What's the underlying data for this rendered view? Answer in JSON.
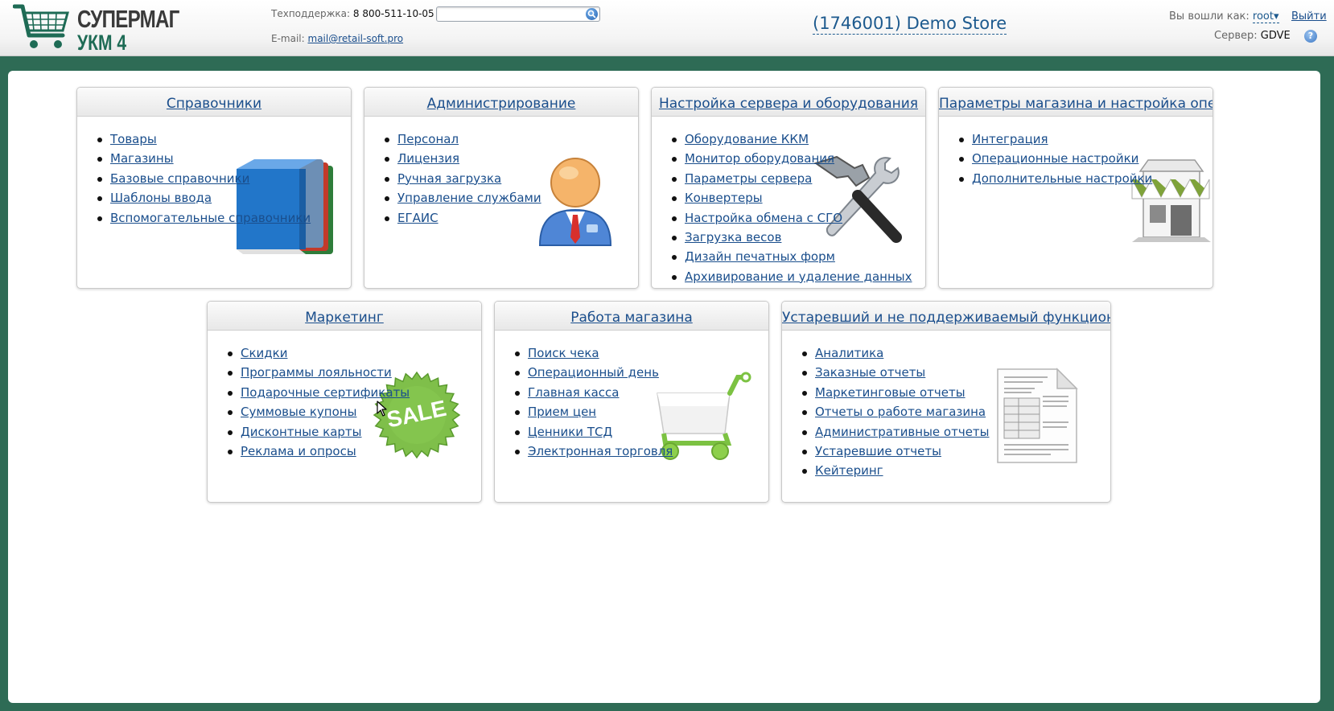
{
  "header": {
    "brand_line1": "СУПЕРМАГ",
    "brand_line2": "УКМ 4",
    "support_label": "Техподдержка:",
    "support_phone": "8 800-511-10-05",
    "email_label": "E-mail:",
    "email": "mail@retail-soft.pro",
    "search_value": "",
    "store_title": "(1746001) Demo Store",
    "login_label": "Вы вошли как:",
    "login_user": "root",
    "logout_label": "Выйти",
    "server_label": "Сервер:",
    "server_value": "GDVE",
    "help_glyph": "?"
  },
  "icons": {
    "logo": "shopping-cart-logo",
    "search": "search-icon",
    "help": "help-icon",
    "user_menu": "chevron-down-icon"
  },
  "colors": {
    "background": "#2e6b55",
    "link": "#1a4e8c",
    "brand_green": "#1e6b55"
  },
  "cards": {
    "directories": {
      "title": "Справочники",
      "items": [
        "Товары",
        "Магазины",
        "Базовые справочники",
        "Шаблоны ввода",
        "Вспомогательные справочники"
      ]
    },
    "administration": {
      "title": "Администрирование",
      "items": [
        "Персонал",
        "Лицензия",
        "Ручная загрузка",
        "Управление службами",
        "ЕГАИС"
      ]
    },
    "server_setup": {
      "title": "Настройка сервера и оборудования",
      "items": [
        "Оборудование ККМ",
        "Монитор оборудования",
        "Параметры сервера",
        "Конвертеры",
        "Настройка обмена с СГО",
        "Загрузка весов",
        "Дизайн печатных форм",
        "Архивирование и удаление данных"
      ]
    },
    "store_params": {
      "title": "Параметры магазина и настройка операций",
      "items": [
        "Интеграция",
        "Операционные настройки",
        "Дополнительные настройки"
      ]
    },
    "marketing": {
      "title": "Маркетинг",
      "items": [
        "Скидки",
        "Программы лояльности",
        "Подарочные сертификаты",
        "Суммовые купоны",
        "Дисконтные карты",
        "Реклама и опросы"
      ],
      "badge_text": "SALE"
    },
    "store_work": {
      "title": "Работа магазина",
      "items": [
        "Поиск чека",
        "Операционный день",
        "Главная касса",
        "Прием цен",
        "Ценники ТСД",
        "Электронная торговля"
      ]
    },
    "legacy": {
      "title": "Устаревший и не поддерживаемый функционал",
      "items": [
        "Аналитика",
        "Заказные отчеты",
        "Маркетинговые отчеты",
        "Отчеты о работе магазина",
        "Административные отчеты",
        "Устаревшие отчеты",
        "Кейтеринг"
      ]
    }
  }
}
